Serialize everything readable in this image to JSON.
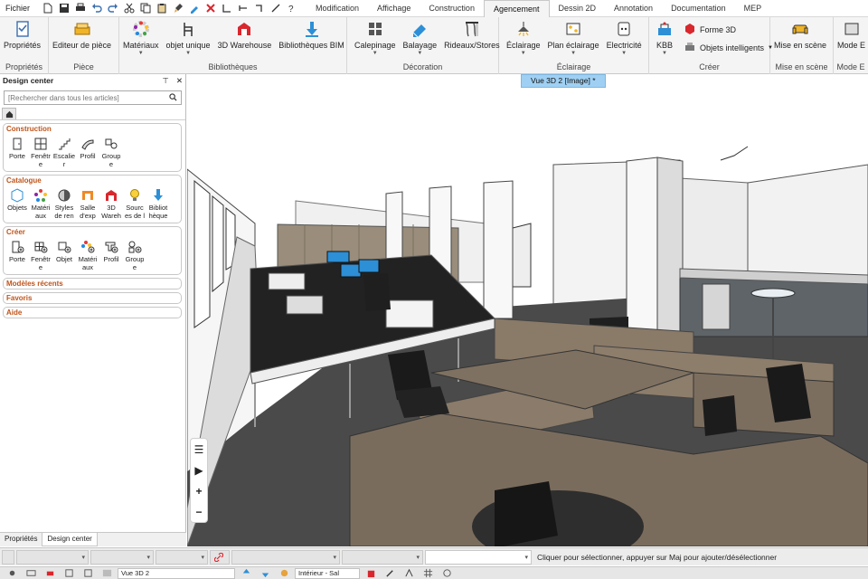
{
  "menubar": {
    "file_label": "Fichier",
    "tabs": [
      {
        "label": "Modification"
      },
      {
        "label": "Affichage"
      },
      {
        "label": "Construction"
      },
      {
        "label": "Agencement",
        "active": true
      },
      {
        "label": "Dessin 2D"
      },
      {
        "label": "Annotation"
      },
      {
        "label": "Documentation"
      },
      {
        "label": "MEP"
      }
    ]
  },
  "ribbon": {
    "groups": [
      {
        "label": "Propriétés",
        "buttons": [
          {
            "label": "Propriétés",
            "icon": "properties-icon"
          }
        ]
      },
      {
        "label": "Pièce",
        "buttons": [
          {
            "label": "Editeur de pièce",
            "icon": "room-editor-icon"
          }
        ]
      },
      {
        "label": "Bibliothèques",
        "buttons": [
          {
            "label": "Matériaux",
            "icon": "materials-icon",
            "caret": true
          },
          {
            "label": "objet unique",
            "icon": "chair-icon",
            "caret": true
          },
          {
            "label": "3D Warehouse",
            "icon": "warehouse-icon"
          },
          {
            "label": "Bibliothèques BIM",
            "icon": "download-icon"
          }
        ]
      },
      {
        "label": "Décoration",
        "buttons": [
          {
            "label": "Calepinage",
            "icon": "tiles-icon",
            "caret": true
          },
          {
            "label": "Balayage",
            "icon": "sweep-icon",
            "caret": true
          },
          {
            "label": "Rideaux/Stores",
            "icon": "curtain-icon"
          }
        ]
      },
      {
        "label": "Éclairage",
        "buttons": [
          {
            "label": "Éclairage",
            "icon": "lamp-icon",
            "caret": true
          },
          {
            "label": "Plan éclairage",
            "icon": "lighting-plan-icon",
            "caret": true
          },
          {
            "label": "Electricité",
            "icon": "electric-icon",
            "caret": true
          }
        ]
      },
      {
        "label": "Créer",
        "buttons": [
          {
            "label": "KBB",
            "icon": "kbb-icon",
            "caret": true
          }
        ],
        "small": [
          {
            "label": "Forme 3D",
            "icon": "shape3d-icon"
          },
          {
            "label": "Objets intelligents",
            "icon": "smart-objects-icon"
          }
        ]
      },
      {
        "label": "Mise en scène",
        "buttons": [
          {
            "label": "Mise en scène",
            "icon": "sofa-icon"
          }
        ]
      },
      {
        "label": "Mode E",
        "buttons": [
          {
            "label": "Mode E",
            "icon": "mode-icon"
          }
        ]
      }
    ]
  },
  "panel": {
    "title": "Design center",
    "search_placeholder": "[Rechercher dans tous les articles]",
    "sections": [
      {
        "title": "Construction",
        "items": [
          {
            "label": "Porte",
            "icon": "door-icon"
          },
          {
            "label": "Fenêtr e",
            "icon": "window-icon"
          },
          {
            "label": "Escalie r",
            "icon": "stairs-icon"
          },
          {
            "label": "Profil",
            "icon": "profile-icon"
          },
          {
            "label": "Group e",
            "icon": "group-icon"
          }
        ]
      },
      {
        "title": "Catalogue",
        "items": [
          {
            "label": "Objets",
            "icon": "objects-icon"
          },
          {
            "label": "Matéri aux",
            "icon": "materials-icon"
          },
          {
            "label": "Styles de ren",
            "icon": "render-styles-icon"
          },
          {
            "label": "Salle d'exp",
            "icon": "showroom-icon"
          },
          {
            "label": "3D Wareh",
            "icon": "warehouse-icon"
          },
          {
            "label": "Sourc es de l",
            "icon": "light-source-icon"
          },
          {
            "label": "Bibliot hèque",
            "icon": "download-icon"
          }
        ]
      },
      {
        "title": "Créer",
        "items": [
          {
            "label": "Porte",
            "icon": "door-create-icon"
          },
          {
            "label": "Fenêtr e",
            "icon": "window-create-icon"
          },
          {
            "label": "Objet",
            "icon": "object-create-icon"
          },
          {
            "label": "Matéri aux",
            "icon": "materials-create-icon"
          },
          {
            "label": "Profil",
            "icon": "profile-create-icon"
          },
          {
            "label": "Group e",
            "icon": "group-create-icon"
          }
        ]
      }
    ],
    "collapsed": [
      {
        "title": "Modèles récents"
      },
      {
        "title": "Favoris"
      },
      {
        "title": "Aide"
      }
    ],
    "tabs": [
      {
        "label": "Propriétés"
      },
      {
        "label": "Design center",
        "active": true
      }
    ]
  },
  "viewport": {
    "tab_label": "Vue 3D 2 [Image] *",
    "nav": [
      "list-icon",
      "play-icon",
      "plus-icon",
      "minus-icon"
    ]
  },
  "statusbar": {
    "message": "Cliquer pour sélectionner, appuyer sur Maj pour ajouter/désélectionner"
  },
  "bottombar": {
    "view_field": "Vue 3D 2",
    "layer_field": "Intérieur - Sal"
  },
  "colors": {
    "accent_orange": "#c0541a",
    "active_tab_blue": "#9fd0f3",
    "ribbon_bg": "#f4f4f4"
  }
}
